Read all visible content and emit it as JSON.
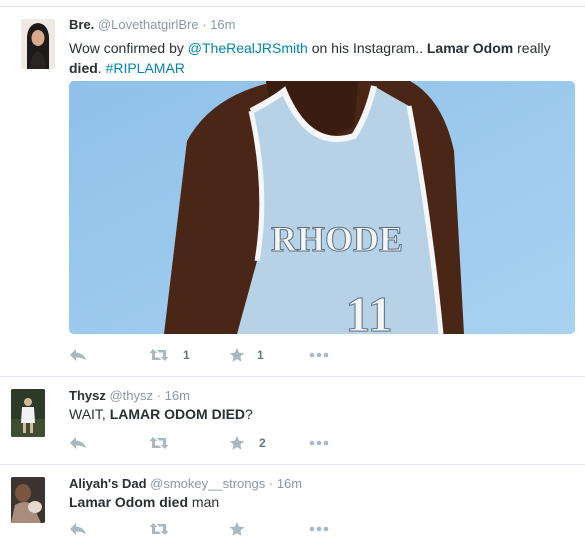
{
  "tweets": [
    {
      "name": "Bre.",
      "handle": "@LovethatgirlBre",
      "separator": "·",
      "time": "16m",
      "text": {
        "p1": "Wow confirmed by ",
        "mention": "@TheRealJRSmith",
        "p2": " on his Instagram.. ",
        "bold1": "Lamar Odom",
        "p3": " really ",
        "bold2": "died",
        "p4": ". ",
        "hashtag": "#RIPLAMAR"
      },
      "media": {
        "jersey_text": "RHODE",
        "jersey_number": "11"
      },
      "retweet_count": "1",
      "favorite_count": "1"
    },
    {
      "name": "Thysz",
      "handle": "@thysz",
      "separator": "·",
      "time": "16m",
      "text": {
        "p1": "WAIT, ",
        "bold1": "LAMAR ODOM DIED",
        "p2": "?"
      },
      "retweet_count": "",
      "favorite_count": "2"
    },
    {
      "name": "Aliyah's Dad",
      "handle": "@smokey__strongs",
      "separator": "·",
      "time": "16m",
      "text": {
        "bold1": "Lamar Odom died",
        "p1": " man"
      },
      "retweet_count": "",
      "favorite_count": ""
    }
  ],
  "icons": {
    "reply": "reply-icon",
    "retweet": "retweet-icon",
    "favorite": "star-icon",
    "more": "more-dots-icon"
  },
  "colors": {
    "link": "#0084b4",
    "icon": "#aab8c2",
    "meta": "#8899a6",
    "divider": "#e1e8ed"
  }
}
